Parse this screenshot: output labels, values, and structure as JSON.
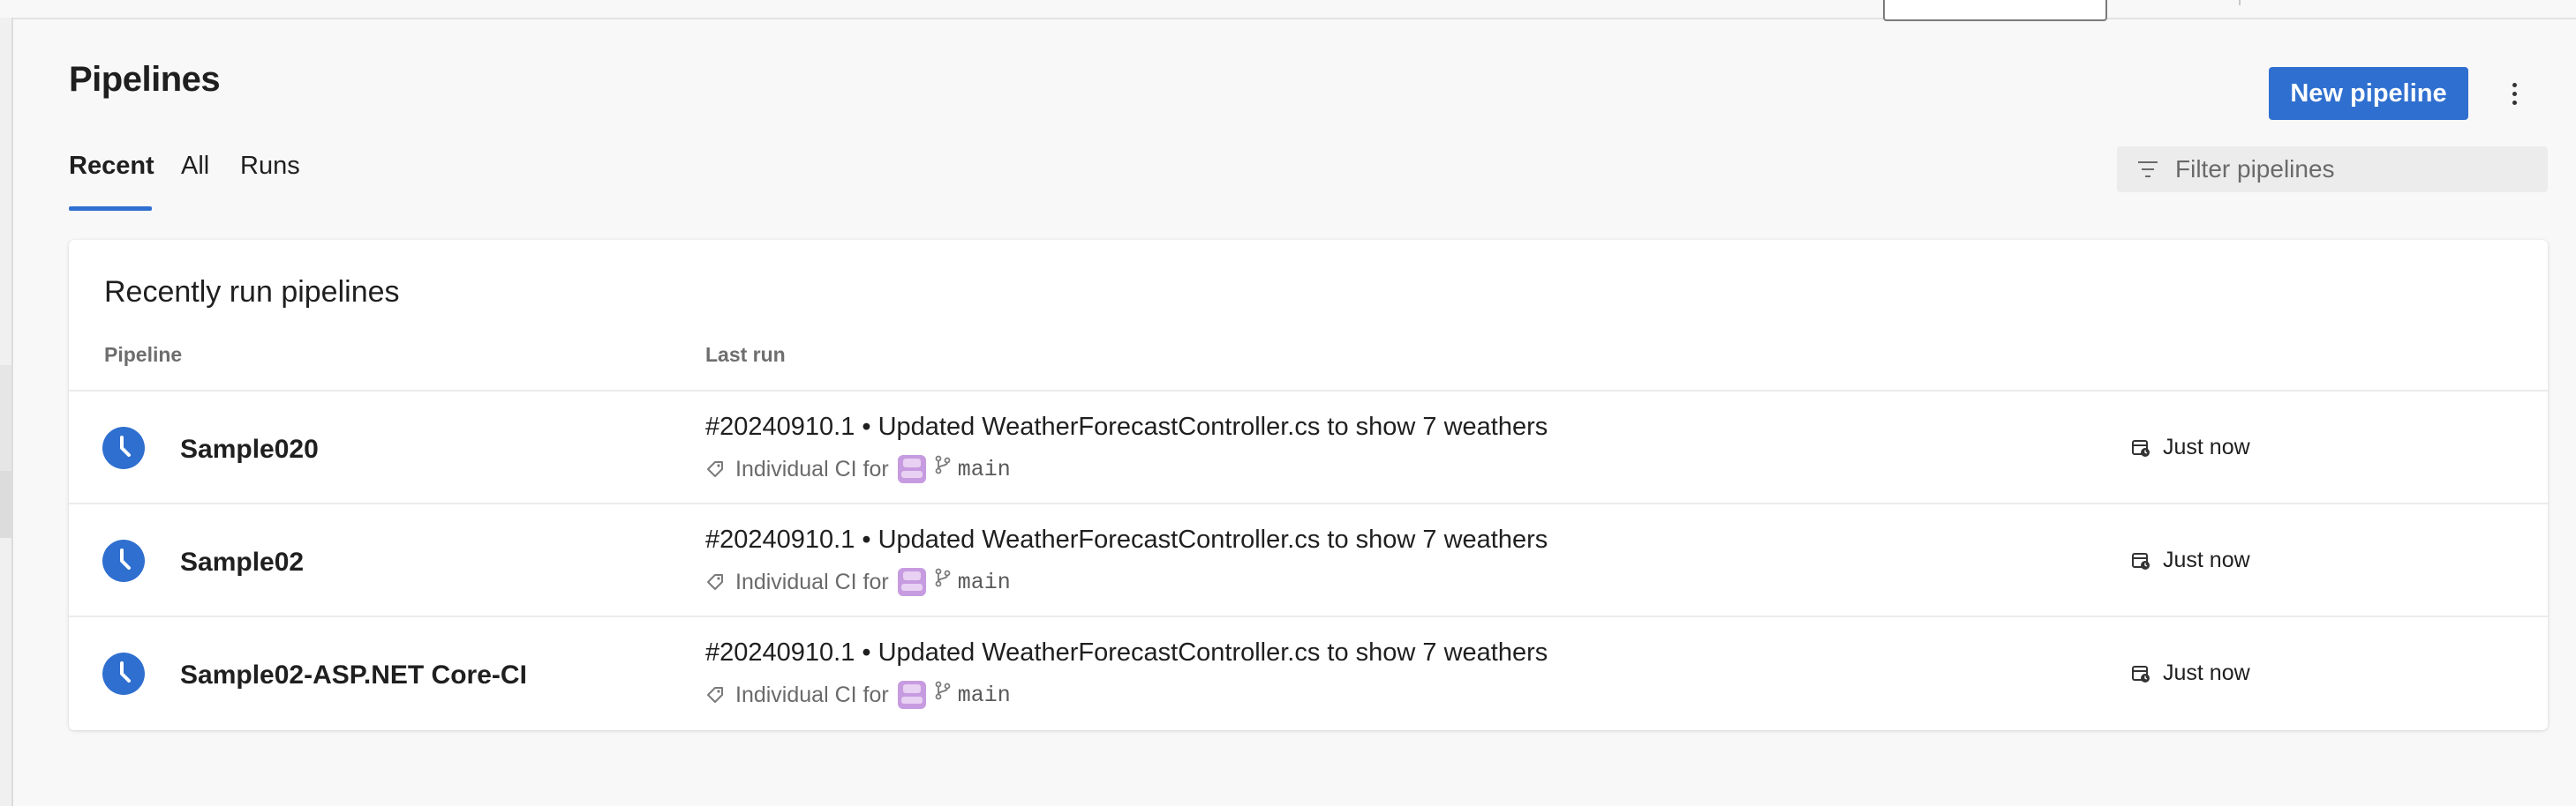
{
  "header": {
    "page_title": "Pipelines",
    "new_button_label": "New pipeline",
    "more_icon": "more-vertical-icon"
  },
  "tabs": [
    {
      "label": "Recent",
      "active": true
    },
    {
      "label": "All",
      "active": false
    },
    {
      "label": "Runs",
      "active": false
    }
  ],
  "filter": {
    "placeholder": "Filter pipelines",
    "icon": "filter-icon"
  },
  "card": {
    "title": "Recently run pipelines",
    "columns": {
      "pipeline": "Pipeline",
      "last_run": "Last run"
    }
  },
  "rows": [
    {
      "name": "Sample020",
      "run_title": "#20240910.1 • Updated WeatherForecastController.cs to show 7 weathers",
      "trigger": "Individual CI for",
      "branch": "main",
      "when": "Just now"
    },
    {
      "name": "Sample02",
      "run_title": "#20240910.1 • Updated WeatherForecastController.cs to show 7 weathers",
      "trigger": "Individual CI for",
      "branch": "main",
      "when": "Just now"
    },
    {
      "name": "Sample02-ASP.NET Core-CI",
      "run_title": "#20240910.1 • Updated WeatherForecastController.cs to show 7 weathers",
      "trigger": "Individual CI for",
      "branch": "main",
      "when": "Just now"
    }
  ],
  "colors": {
    "accent": "#2f6fcf",
    "status_queued": "#2f6fcf",
    "avatar": "#c79be0",
    "background": "#f8f8f8"
  }
}
